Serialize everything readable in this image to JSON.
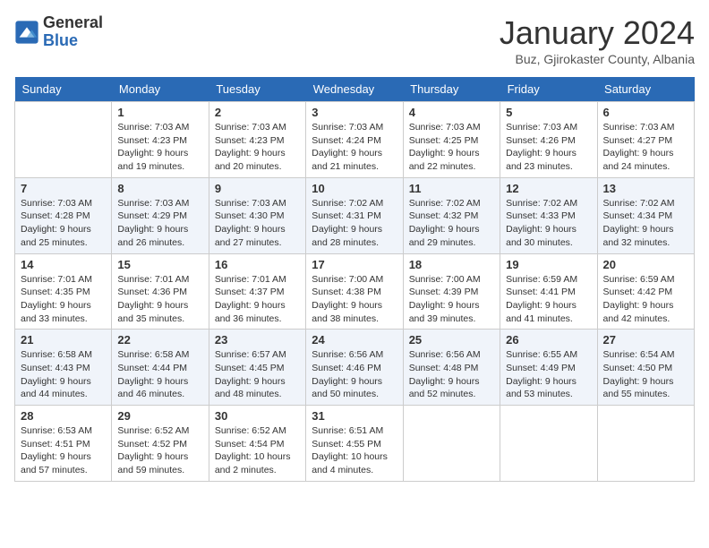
{
  "header": {
    "logo_general": "General",
    "logo_blue": "Blue",
    "month_title": "January 2024",
    "subtitle": "Buz, Gjirokaster County, Albania"
  },
  "weekdays": [
    "Sunday",
    "Monday",
    "Tuesday",
    "Wednesday",
    "Thursday",
    "Friday",
    "Saturday"
  ],
  "weeks": [
    [
      {
        "day": "",
        "sunrise": "",
        "sunset": "",
        "daylight": ""
      },
      {
        "day": "1",
        "sunrise": "Sunrise: 7:03 AM",
        "sunset": "Sunset: 4:23 PM",
        "daylight": "Daylight: 9 hours and 19 minutes."
      },
      {
        "day": "2",
        "sunrise": "Sunrise: 7:03 AM",
        "sunset": "Sunset: 4:23 PM",
        "daylight": "Daylight: 9 hours and 20 minutes."
      },
      {
        "day": "3",
        "sunrise": "Sunrise: 7:03 AM",
        "sunset": "Sunset: 4:24 PM",
        "daylight": "Daylight: 9 hours and 21 minutes."
      },
      {
        "day": "4",
        "sunrise": "Sunrise: 7:03 AM",
        "sunset": "Sunset: 4:25 PM",
        "daylight": "Daylight: 9 hours and 22 minutes."
      },
      {
        "day": "5",
        "sunrise": "Sunrise: 7:03 AM",
        "sunset": "Sunset: 4:26 PM",
        "daylight": "Daylight: 9 hours and 23 minutes."
      },
      {
        "day": "6",
        "sunrise": "Sunrise: 7:03 AM",
        "sunset": "Sunset: 4:27 PM",
        "daylight": "Daylight: 9 hours and 24 minutes."
      }
    ],
    [
      {
        "day": "7",
        "sunrise": "Sunrise: 7:03 AM",
        "sunset": "Sunset: 4:28 PM",
        "daylight": "Daylight: 9 hours and 25 minutes."
      },
      {
        "day": "8",
        "sunrise": "Sunrise: 7:03 AM",
        "sunset": "Sunset: 4:29 PM",
        "daylight": "Daylight: 9 hours and 26 minutes."
      },
      {
        "day": "9",
        "sunrise": "Sunrise: 7:03 AM",
        "sunset": "Sunset: 4:30 PM",
        "daylight": "Daylight: 9 hours and 27 minutes."
      },
      {
        "day": "10",
        "sunrise": "Sunrise: 7:02 AM",
        "sunset": "Sunset: 4:31 PM",
        "daylight": "Daylight: 9 hours and 28 minutes."
      },
      {
        "day": "11",
        "sunrise": "Sunrise: 7:02 AM",
        "sunset": "Sunset: 4:32 PM",
        "daylight": "Daylight: 9 hours and 29 minutes."
      },
      {
        "day": "12",
        "sunrise": "Sunrise: 7:02 AM",
        "sunset": "Sunset: 4:33 PM",
        "daylight": "Daylight: 9 hours and 30 minutes."
      },
      {
        "day": "13",
        "sunrise": "Sunrise: 7:02 AM",
        "sunset": "Sunset: 4:34 PM",
        "daylight": "Daylight: 9 hours and 32 minutes."
      }
    ],
    [
      {
        "day": "14",
        "sunrise": "Sunrise: 7:01 AM",
        "sunset": "Sunset: 4:35 PM",
        "daylight": "Daylight: 9 hours and 33 minutes."
      },
      {
        "day": "15",
        "sunrise": "Sunrise: 7:01 AM",
        "sunset": "Sunset: 4:36 PM",
        "daylight": "Daylight: 9 hours and 35 minutes."
      },
      {
        "day": "16",
        "sunrise": "Sunrise: 7:01 AM",
        "sunset": "Sunset: 4:37 PM",
        "daylight": "Daylight: 9 hours and 36 minutes."
      },
      {
        "day": "17",
        "sunrise": "Sunrise: 7:00 AM",
        "sunset": "Sunset: 4:38 PM",
        "daylight": "Daylight: 9 hours and 38 minutes."
      },
      {
        "day": "18",
        "sunrise": "Sunrise: 7:00 AM",
        "sunset": "Sunset: 4:39 PM",
        "daylight": "Daylight: 9 hours and 39 minutes."
      },
      {
        "day": "19",
        "sunrise": "Sunrise: 6:59 AM",
        "sunset": "Sunset: 4:41 PM",
        "daylight": "Daylight: 9 hours and 41 minutes."
      },
      {
        "day": "20",
        "sunrise": "Sunrise: 6:59 AM",
        "sunset": "Sunset: 4:42 PM",
        "daylight": "Daylight: 9 hours and 42 minutes."
      }
    ],
    [
      {
        "day": "21",
        "sunrise": "Sunrise: 6:58 AM",
        "sunset": "Sunset: 4:43 PM",
        "daylight": "Daylight: 9 hours and 44 minutes."
      },
      {
        "day": "22",
        "sunrise": "Sunrise: 6:58 AM",
        "sunset": "Sunset: 4:44 PM",
        "daylight": "Daylight: 9 hours and 46 minutes."
      },
      {
        "day": "23",
        "sunrise": "Sunrise: 6:57 AM",
        "sunset": "Sunset: 4:45 PM",
        "daylight": "Daylight: 9 hours and 48 minutes."
      },
      {
        "day": "24",
        "sunrise": "Sunrise: 6:56 AM",
        "sunset": "Sunset: 4:46 PM",
        "daylight": "Daylight: 9 hours and 50 minutes."
      },
      {
        "day": "25",
        "sunrise": "Sunrise: 6:56 AM",
        "sunset": "Sunset: 4:48 PM",
        "daylight": "Daylight: 9 hours and 52 minutes."
      },
      {
        "day": "26",
        "sunrise": "Sunrise: 6:55 AM",
        "sunset": "Sunset: 4:49 PM",
        "daylight": "Daylight: 9 hours and 53 minutes."
      },
      {
        "day": "27",
        "sunrise": "Sunrise: 6:54 AM",
        "sunset": "Sunset: 4:50 PM",
        "daylight": "Daylight: 9 hours and 55 minutes."
      }
    ],
    [
      {
        "day": "28",
        "sunrise": "Sunrise: 6:53 AM",
        "sunset": "Sunset: 4:51 PM",
        "daylight": "Daylight: 9 hours and 57 minutes."
      },
      {
        "day": "29",
        "sunrise": "Sunrise: 6:52 AM",
        "sunset": "Sunset: 4:52 PM",
        "daylight": "Daylight: 9 hours and 59 minutes."
      },
      {
        "day": "30",
        "sunrise": "Sunrise: 6:52 AM",
        "sunset": "Sunset: 4:54 PM",
        "daylight": "Daylight: 10 hours and 2 minutes."
      },
      {
        "day": "31",
        "sunrise": "Sunrise: 6:51 AM",
        "sunset": "Sunset: 4:55 PM",
        "daylight": "Daylight: 10 hours and 4 minutes."
      },
      {
        "day": "",
        "sunrise": "",
        "sunset": "",
        "daylight": ""
      },
      {
        "day": "",
        "sunrise": "",
        "sunset": "",
        "daylight": ""
      },
      {
        "day": "",
        "sunrise": "",
        "sunset": "",
        "daylight": ""
      }
    ]
  ]
}
